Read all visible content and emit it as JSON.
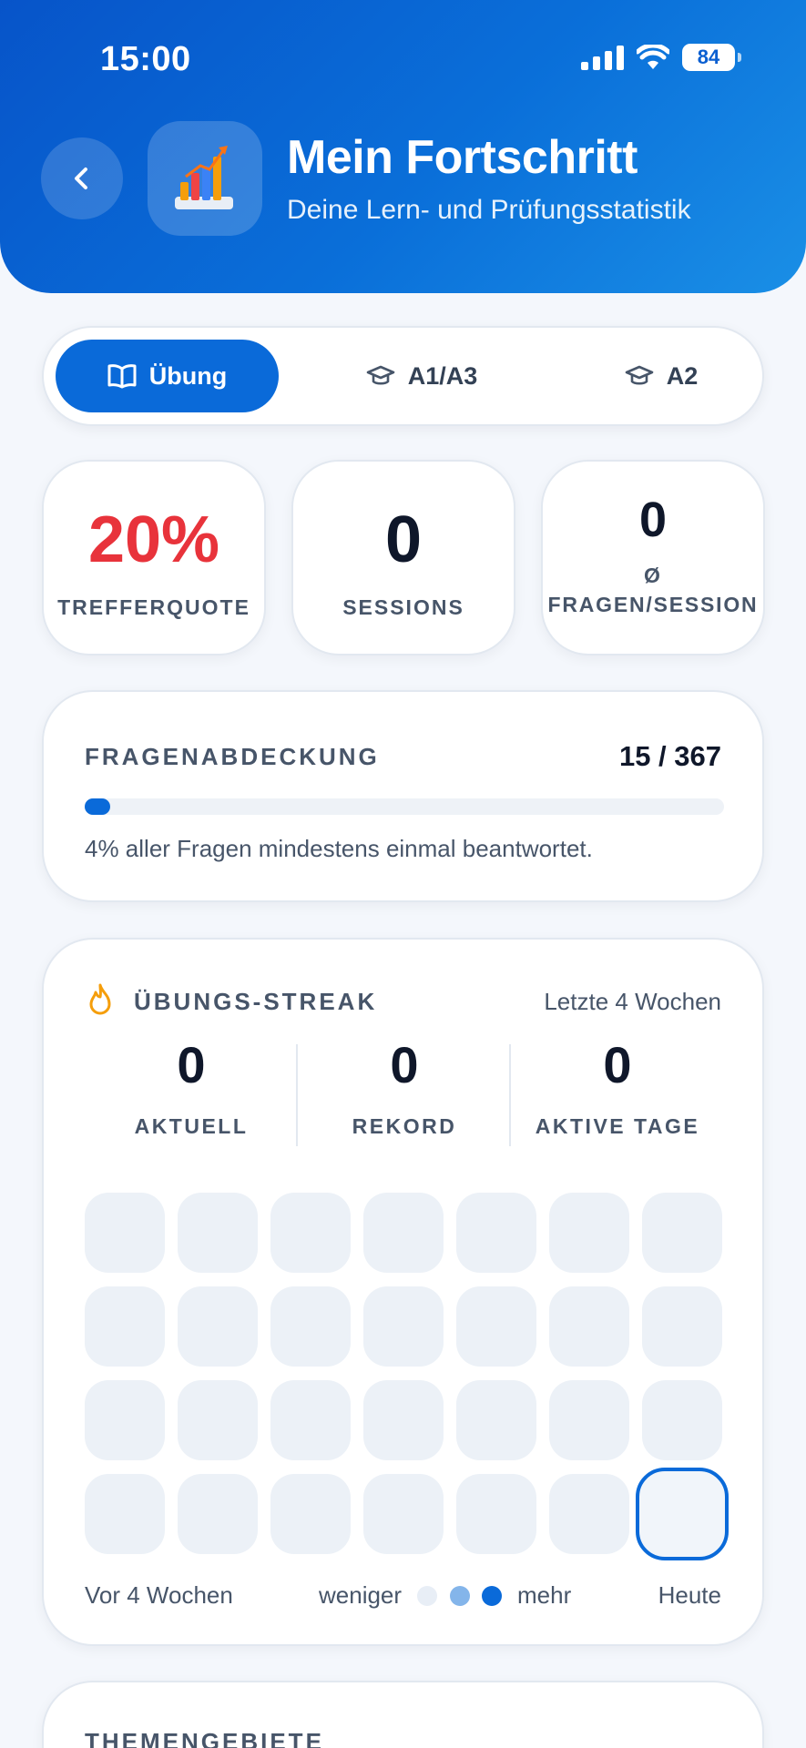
{
  "status_bar": {
    "time": "15:00",
    "battery": "84"
  },
  "header": {
    "title": "Mein Fortschritt",
    "subtitle": "Deine Lern- und Prüfungsstatistik"
  },
  "tabs": [
    {
      "label": "Übung",
      "icon": "book-icon",
      "active": true
    },
    {
      "label": "A1/A3",
      "icon": "graduation-cap-icon",
      "active": false
    },
    {
      "label": "A2",
      "icon": "graduation-cap-icon",
      "active": false
    }
  ],
  "stats": [
    {
      "value": "20%",
      "label": "TREFFERQUOTE",
      "color": "#e8333b"
    },
    {
      "value": "0",
      "label": "SESSIONS"
    },
    {
      "value": "0",
      "label_line1": "Ø",
      "label_line2": "FRAGEN/SESSION"
    }
  ],
  "coverage": {
    "label": "FRAGENABDECKUNG",
    "count": "15 / 367",
    "progress_fraction": 0.04,
    "note": "4% aller Fragen mindestens einmal beantwortet."
  },
  "streak": {
    "label": "ÜBUNGS-STREAK",
    "period": "Letzte 4 Wochen",
    "current": {
      "value": "0",
      "label": "AKTUELL"
    },
    "record": {
      "value": "0",
      "label": "REKORD"
    },
    "active_days": {
      "value": "0",
      "label": "AKTIVE TAGE"
    },
    "legend_start": "Vor 4 Wochen",
    "legend_less": "weniger",
    "legend_more": "mehr",
    "legend_end": "Heute",
    "legend_colors": [
      "#e8eef6",
      "#84b5ea",
      "#0a6ad9"
    ]
  },
  "topics": {
    "label": "THEMENGEBIETE"
  },
  "colors": {
    "accent": "#0a6ad9",
    "header_start": "#0754c9",
    "header_end": "#1a8fe6"
  }
}
